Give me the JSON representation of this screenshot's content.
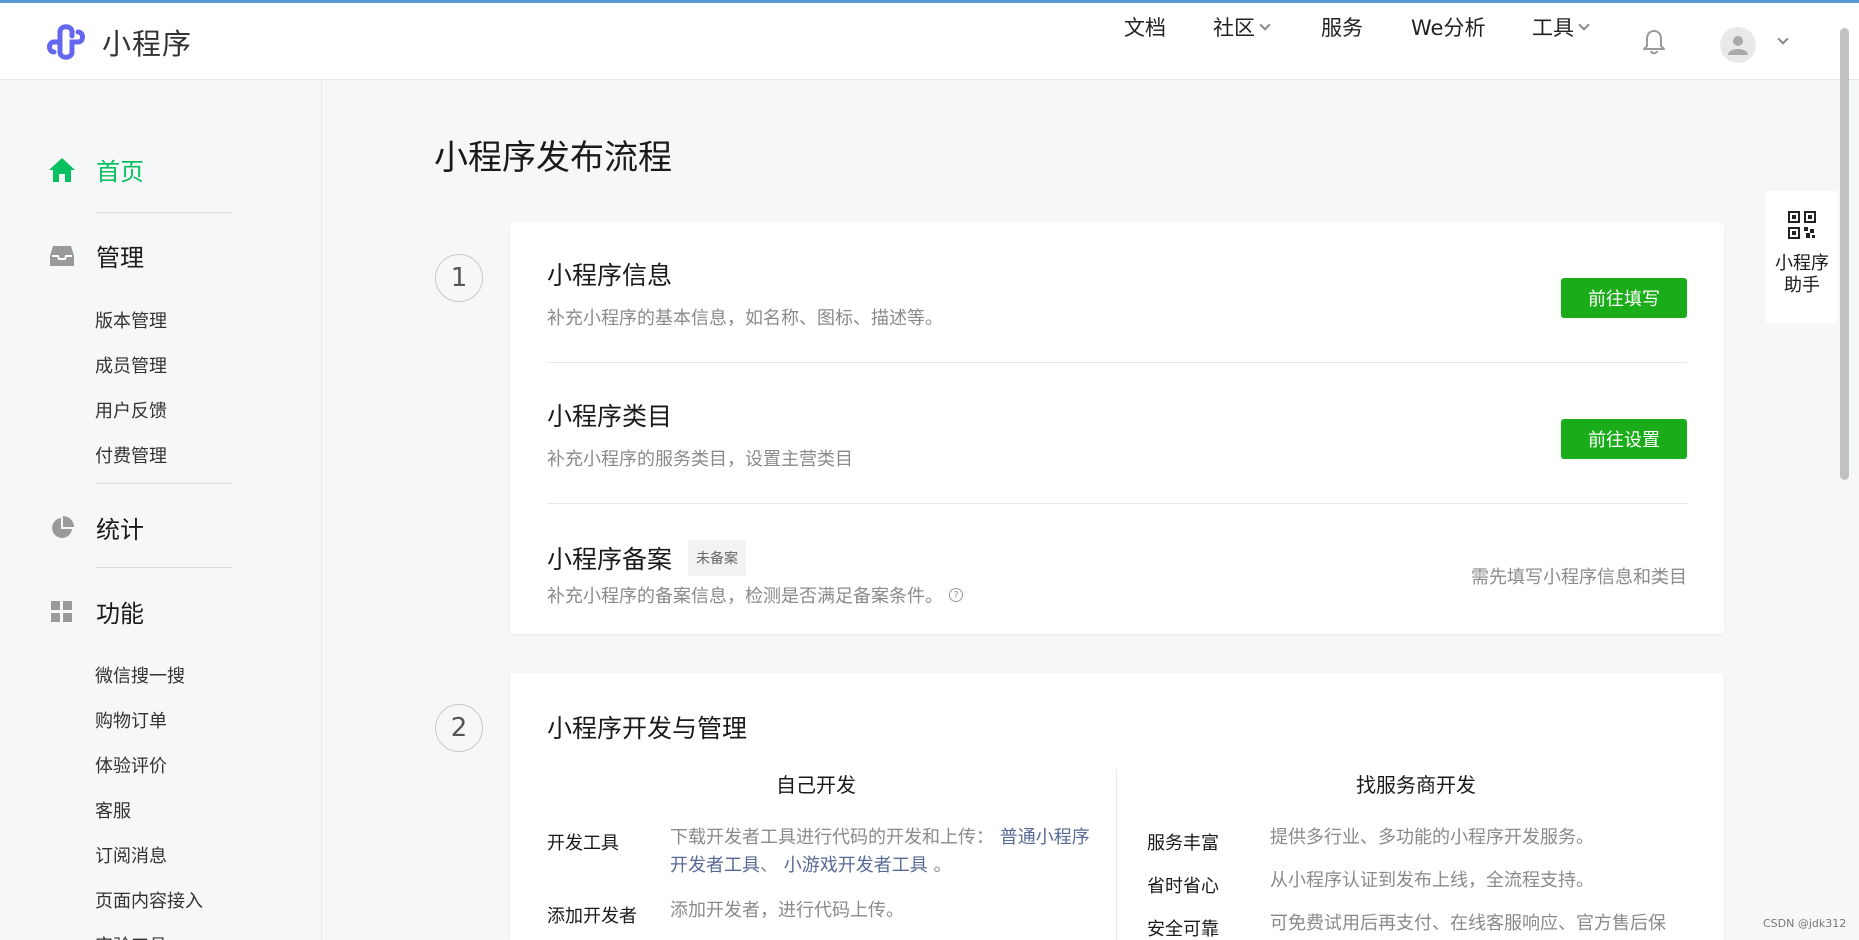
{
  "header": {
    "app_name": "小程序",
    "nav": [
      {
        "label": "文档",
        "has_dropdown": false
      },
      {
        "label": "社区",
        "has_dropdown": true
      },
      {
        "label": "服务",
        "has_dropdown": false
      },
      {
        "label": "We分析",
        "has_dropdown": false
      },
      {
        "label": "工具",
        "has_dropdown": true
      }
    ],
    "icons": {
      "bell": "bell-icon",
      "avatar": "user-avatar-icon"
    }
  },
  "sidebar": {
    "home": {
      "label": "首页",
      "icon": "home-icon"
    },
    "manage": {
      "label": "管理",
      "icon": "inbox-icon",
      "items": [
        "版本管理",
        "成员管理",
        "用户反馈",
        "付费管理"
      ]
    },
    "stats": {
      "label": "统计",
      "icon": "pie-chart-icon"
    },
    "features": {
      "label": "功能",
      "icon": "grid-icon",
      "items": [
        "微信搜一搜",
        "购物订单",
        "体验评价",
        "客服",
        "订阅消息",
        "页面内容接入",
        "实验工具"
      ]
    }
  },
  "main": {
    "title": "小程序发布流程",
    "step1": {
      "number": "1",
      "rows": [
        {
          "title": "小程序信息",
          "desc": "补充小程序的基本信息，如名称、图标、描述等。",
          "button": "前往填写"
        },
        {
          "title": "小程序类目",
          "desc": "补充小程序的服务类目，设置主营类目",
          "button": "前往设置"
        },
        {
          "title": "小程序备案",
          "badge": "未备案",
          "desc": "补充小程序的备案信息，检测是否满足备案条件。",
          "hint": "需先填写小程序信息和类目"
        }
      ]
    },
    "step2": {
      "number": "2",
      "title": "小程序开发与管理",
      "self_dev": {
        "heading": "自己开发",
        "items": [
          {
            "key": "开发工具",
            "text": "下载开发者工具进行代码的开发和上传：",
            "link1": "普通小程序开发者工具",
            "sep": "、",
            "link2": "小游戏开发者工具",
            "end": "。"
          },
          {
            "key": "添加开发者",
            "text": "添加开发者，进行代码上传。"
          }
        ]
      },
      "vendor_dev": {
        "heading": "找服务商开发",
        "items": [
          {
            "key": "服务丰富",
            "text": "提供多行业、多功能的小程序开发服务。"
          },
          {
            "key": "省时省心",
            "text": "从小程序认证到发布上线，全流程支持。"
          },
          {
            "key": "安全可靠",
            "text": "可免费试用后再支付、在线客服响应、官方售后保"
          }
        ]
      }
    }
  },
  "helper": {
    "label": "小程序助手",
    "icon": "qr-code-icon"
  },
  "watermark": "CSDN @jdk312"
}
